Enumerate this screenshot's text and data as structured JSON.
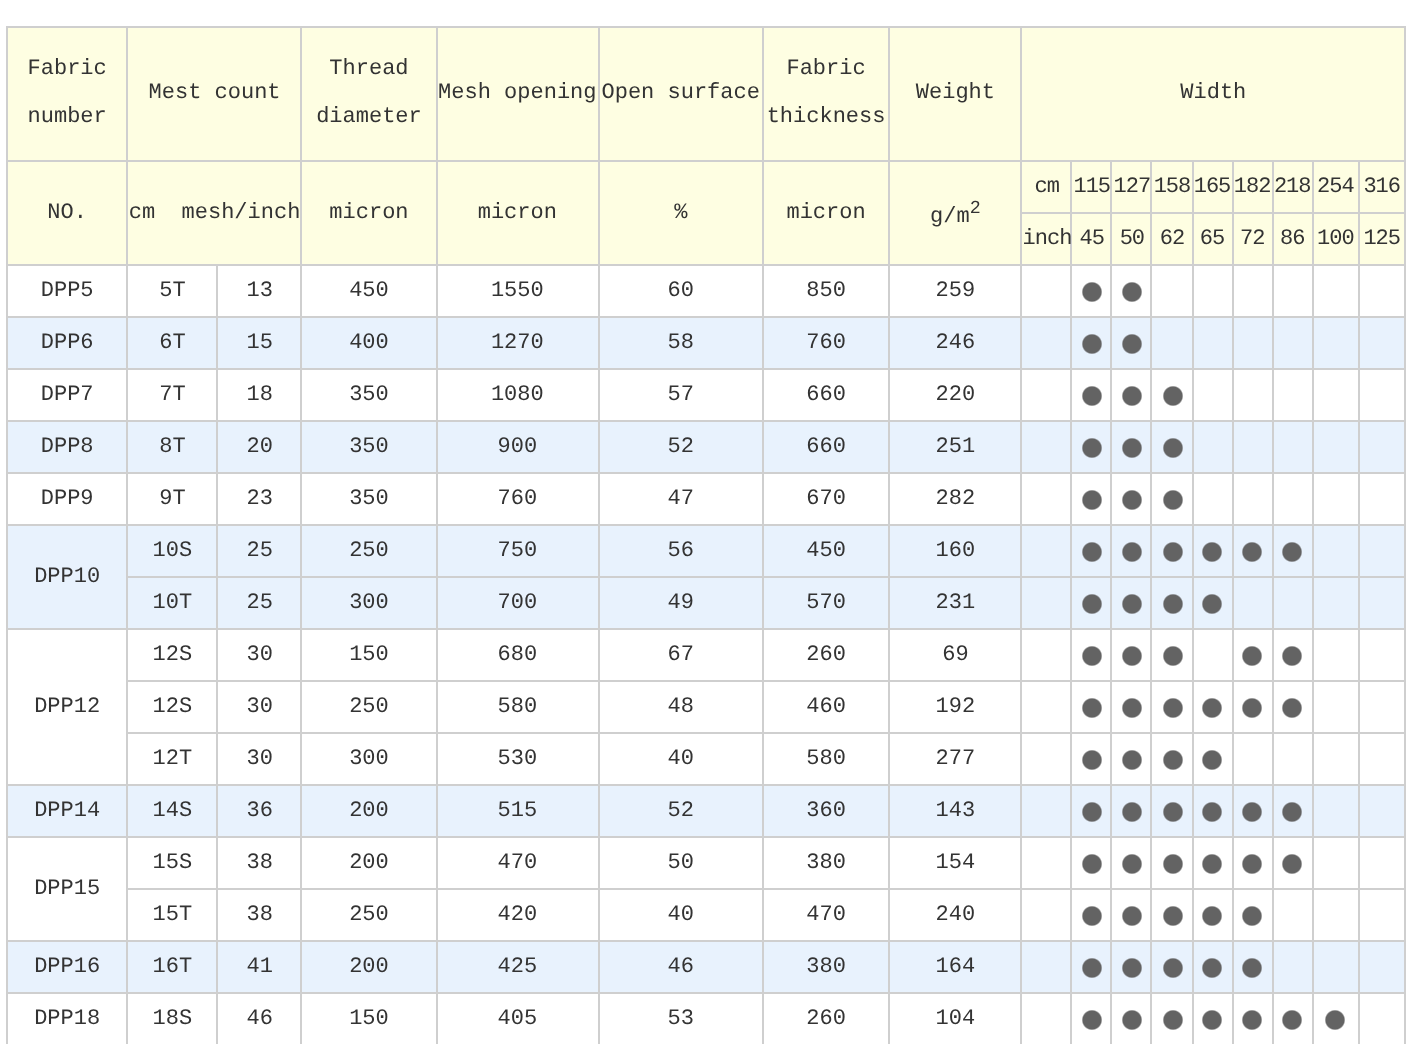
{
  "columns": [
    {
      "title": "Fabric number",
      "unit": "NO."
    },
    {
      "title": "Mest count",
      "unit": "cm  mesh/inch"
    },
    {
      "title": "Thread diameter",
      "unit": "micron"
    },
    {
      "title": "Mesh opening",
      "unit": "micron"
    },
    {
      "title": "Open surface",
      "unit": "%"
    },
    {
      "title": "Fabric thickness",
      "unit": "micron"
    },
    {
      "title": "Weight",
      "unit": "g/m$^{2}$"
    }
  ],
  "width": {
    "title": "Width",
    "cm_label": "cm",
    "cm": [
      "115",
      "127",
      "158",
      "165",
      "182",
      "218",
      "254",
      "316"
    ],
    "inch_label": "inch",
    "inch": [
      "45",
      "50",
      "62",
      "65",
      "72",
      "86",
      "100",
      "125"
    ]
  },
  "groups": [
    {
      "fabric": "DPP5",
      "rows": [
        {
          "cm": "5T",
          "mesh": "13",
          "thread": "450",
          "opening": "1550",
          "surface": "60",
          "thickness": "850",
          "weight": "259",
          "available": [
            true,
            true,
            false,
            false,
            false,
            false,
            false,
            false
          ]
        }
      ]
    },
    {
      "fabric": "DPP6",
      "rows": [
        {
          "cm": "6T",
          "mesh": "15",
          "thread": "400",
          "opening": "1270",
          "surface": "58",
          "thickness": "760",
          "weight": "246",
          "available": [
            true,
            true,
            false,
            false,
            false,
            false,
            false,
            false
          ]
        }
      ]
    },
    {
      "fabric": "DPP7",
      "rows": [
        {
          "cm": "7T",
          "mesh": "18",
          "thread": "350",
          "opening": "1080",
          "surface": "57",
          "thickness": "660",
          "weight": "220",
          "available": [
            true,
            true,
            true,
            false,
            false,
            false,
            false,
            false
          ]
        }
      ]
    },
    {
      "fabric": "DPP8",
      "rows": [
        {
          "cm": "8T",
          "mesh": "20",
          "thread": "350",
          "opening": "900",
          "surface": "52",
          "thickness": "660",
          "weight": "251",
          "available": [
            true,
            true,
            true,
            false,
            false,
            false,
            false,
            false
          ]
        }
      ]
    },
    {
      "fabric": "DPP9",
      "rows": [
        {
          "cm": "9T",
          "mesh": "23",
          "thread": "350",
          "opening": "760",
          "surface": "47",
          "thickness": "670",
          "weight": "282",
          "available": [
            true,
            true,
            true,
            false,
            false,
            false,
            false,
            false
          ]
        }
      ]
    },
    {
      "fabric": "DPP10",
      "rows": [
        {
          "cm": "10S",
          "mesh": "25",
          "thread": "250",
          "opening": "750",
          "surface": "56",
          "thickness": "450",
          "weight": "160",
          "available": [
            true,
            true,
            true,
            true,
            true,
            true,
            false,
            false
          ]
        },
        {
          "cm": "10T",
          "mesh": "25",
          "thread": "300",
          "opening": "700",
          "surface": "49",
          "thickness": "570",
          "weight": "231",
          "available": [
            true,
            true,
            true,
            true,
            false,
            false,
            false,
            false
          ]
        }
      ]
    },
    {
      "fabric": "DPP12",
      "rows": [
        {
          "cm": "12S",
          "mesh": "30",
          "thread": "150",
          "opening": "680",
          "surface": "67",
          "thickness": "260",
          "weight": "69",
          "available": [
            true,
            true,
            true,
            false,
            true,
            true,
            false,
            false
          ]
        },
        {
          "cm": "12S",
          "mesh": "30",
          "thread": "250",
          "opening": "580",
          "surface": "48",
          "thickness": "460",
          "weight": "192",
          "available": [
            true,
            true,
            true,
            true,
            true,
            true,
            false,
            false
          ]
        },
        {
          "cm": "12T",
          "mesh": "30",
          "thread": "300",
          "opening": "530",
          "surface": "40",
          "thickness": "580",
          "weight": "277",
          "available": [
            true,
            true,
            true,
            true,
            false,
            false,
            false,
            false
          ]
        }
      ]
    },
    {
      "fabric": "DPP14",
      "rows": [
        {
          "cm": "14S",
          "mesh": "36",
          "thread": "200",
          "opening": "515",
          "surface": "52",
          "thickness": "360",
          "weight": "143",
          "available": [
            true,
            true,
            true,
            true,
            true,
            true,
            false,
            false
          ]
        }
      ]
    },
    {
      "fabric": "DPP15",
      "rows": [
        {
          "cm": "15S",
          "mesh": "38",
          "thread": "200",
          "opening": "470",
          "surface": "50",
          "thickness": "380",
          "weight": "154",
          "available": [
            true,
            true,
            true,
            true,
            true,
            true,
            false,
            false
          ]
        },
        {
          "cm": "15T",
          "mesh": "38",
          "thread": "250",
          "opening": "420",
          "surface": "40",
          "thickness": "470",
          "weight": "240",
          "available": [
            true,
            true,
            true,
            true,
            true,
            false,
            false,
            false
          ]
        }
      ]
    },
    {
      "fabric": "DPP16",
      "rows": [
        {
          "cm": "16T",
          "mesh": "41",
          "thread": "200",
          "opening": "425",
          "surface": "46",
          "thickness": "380",
          "weight": "164",
          "available": [
            true,
            true,
            true,
            true,
            true,
            false,
            false,
            false
          ]
        }
      ]
    },
    {
      "fabric": "DPP18",
      "rows": [
        {
          "cm": "18S",
          "mesh": "46",
          "thread": "150",
          "opening": "405",
          "surface": "53",
          "thickness": "260",
          "weight": "104",
          "available": [
            true,
            true,
            true,
            true,
            true,
            true,
            true,
            false
          ]
        }
      ]
    }
  ]
}
